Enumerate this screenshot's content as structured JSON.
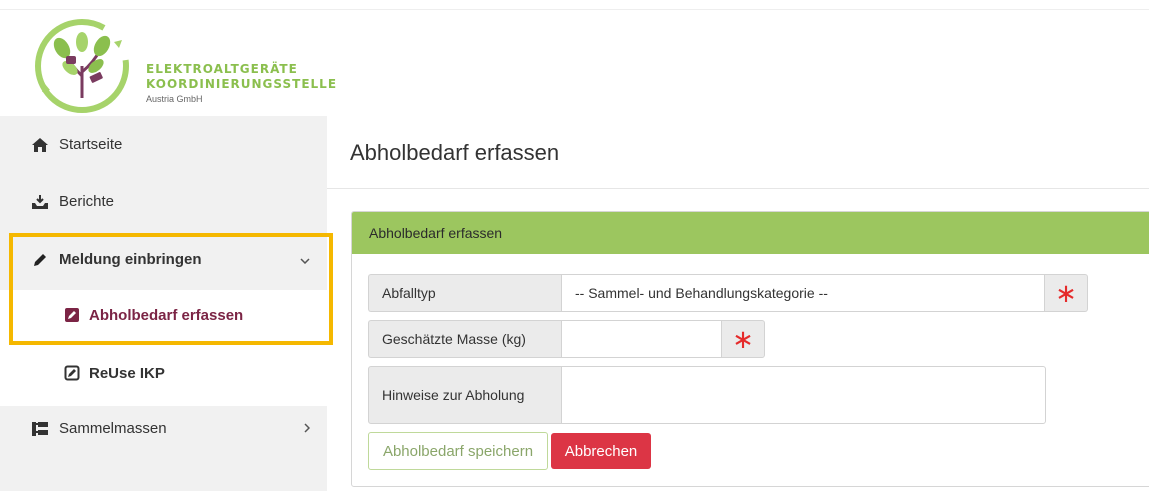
{
  "brand": {
    "line1": "ELEKTROALTGERÄTE",
    "line2": "KOORDINIERUNGSSTELLE",
    "line3": "Austria GmbH",
    "color": "#8bbf4e"
  },
  "sidebar": {
    "items": [
      {
        "label": "Startseite",
        "icon": "home-icon"
      },
      {
        "label": "Berichte",
        "icon": "inbox-download-icon"
      },
      {
        "label": "Meldung einbringen",
        "icon": "pencil-icon",
        "expanded": true
      },
      {
        "label": "Sammelmassen",
        "icon": "sitemap-icon",
        "expanded": false
      }
    ],
    "subitems": [
      {
        "label": "Abholbedarf erfassen",
        "icon": "edit-square-icon",
        "active": true,
        "color": "#7b2445"
      },
      {
        "label": "ReUse IKP",
        "icon": "edit-square-outline-icon",
        "active": false
      }
    ]
  },
  "main": {
    "title": "Abholbedarf erfassen"
  },
  "form": {
    "header": "Abholbedarf erfassen",
    "header_color": "#9cc65f",
    "fields": [
      {
        "label": "Abfalltyp",
        "value": "-- Sammel- und Behandlungskategorie --",
        "required": true
      },
      {
        "label": "Geschätzte Masse (kg)",
        "value": "",
        "required": true
      },
      {
        "label": "Hinweise zur Abholung",
        "value": "",
        "required": false
      }
    ],
    "required_mark": "∗",
    "save_label": "Abholbedarf speichern",
    "cancel_label": "Abbrechen",
    "cancel_color": "#dc3545"
  }
}
